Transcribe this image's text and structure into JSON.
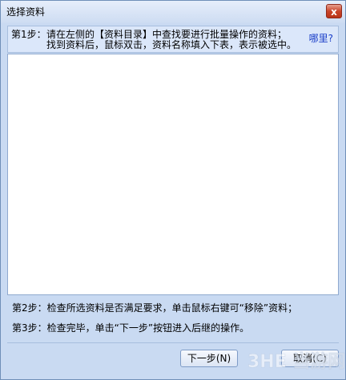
{
  "window": {
    "title": "选择资料",
    "close_label": "x"
  },
  "step1": {
    "label": "第1步：",
    "line1": "请在左侧的【资料目录】中查找要进行批量操作的资料；",
    "line2": "找到资料后，鼠标双击，资料名称填入下表，表示被选中。",
    "where_link": "哪里?"
  },
  "list": {
    "items": []
  },
  "step2": {
    "text": "第2步：检查所选资料是否满足要求，单击鼠标右键可“移除”资料；"
  },
  "step3": {
    "text": "第3步：检查完毕，单击“下一步”按钮进入后继的操作。"
  },
  "buttons": {
    "next_label": "下一步(N)",
    "cancel_label": "取消(C)"
  },
  "colors": {
    "window_bg": "#c9daf2",
    "link": "#1a3ec8",
    "close_red": "#c9442a"
  },
  "watermark": {
    "text": "3HE 当游网"
  }
}
